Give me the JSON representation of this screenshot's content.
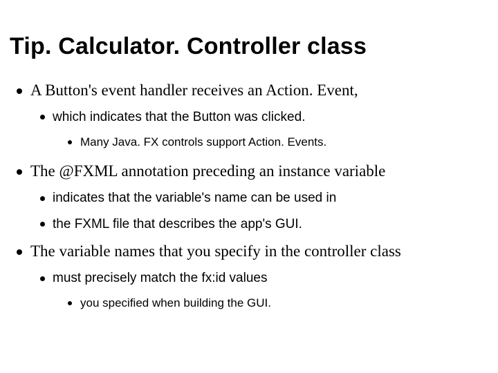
{
  "title": "Tip. Calculator. Controller class",
  "items": [
    {
      "text": "A Button's event handler receives an Action. Event,",
      "children": [
        {
          "text": "which indicates that the Button was clicked.",
          "children": [
            {
              "text": "Many Java. FX controls support Action. Events."
            }
          ]
        }
      ]
    },
    {
      "text": "The @FXML annotation preceding an instance variable",
      "children": [
        {
          "text": "indicates that the variable's name can be used in"
        },
        {
          "text": "the FXML file that describes the app's GUI."
        }
      ]
    },
    {
      "text": "The variable names that you specify in the controller class",
      "children": [
        {
          "text": "must precisely match the fx:id values",
          "children": [
            {
              "text": "you specified when building the GUI."
            }
          ]
        }
      ]
    }
  ]
}
